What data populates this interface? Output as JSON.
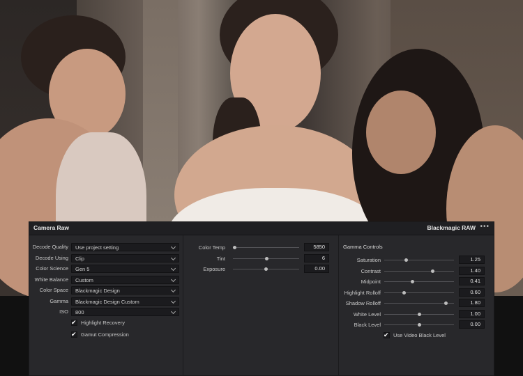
{
  "panel": {
    "title": "Camera Raw",
    "brand": "Blackmagic RAW",
    "menu_label": "•••"
  },
  "decode": {
    "rows": [
      {
        "label": "Decode Quality",
        "value": "Use project setting"
      },
      {
        "label": "Decode Using",
        "value": "Clip"
      },
      {
        "label": "Color Science",
        "value": "Gen 5"
      },
      {
        "label": "White Balance",
        "value": "Custom"
      },
      {
        "label": "Color Space",
        "value": "Blackmagic Design"
      },
      {
        "label": "Gamma",
        "value": "Blackmagic Design Custom"
      },
      {
        "label": "ISO",
        "value": "800"
      }
    ],
    "checkboxes": [
      {
        "label": "Highlight Recovery",
        "checked": true
      },
      {
        "label": "Gamut Compression",
        "checked": true
      }
    ]
  },
  "color": {
    "sliders": [
      {
        "label": "Color Temp",
        "value": "5850",
        "position": 0.03
      },
      {
        "label": "Tint",
        "value": "6",
        "position": 0.51
      },
      {
        "label": "Exposure",
        "value": "0.00",
        "position": 0.5
      }
    ]
  },
  "gamma": {
    "title": "Gamma Controls",
    "sliders": [
      {
        "label": "Saturation",
        "value": "1.25",
        "position": 0.31
      },
      {
        "label": "Contrast",
        "value": "1.40",
        "position": 0.69
      },
      {
        "label": "Midpoint",
        "value": "0.41",
        "position": 0.4
      },
      {
        "label": "Highlight Rolloff",
        "value": "0.60",
        "position": 0.28
      },
      {
        "label": "Shadow Rolloff",
        "value": "1.80",
        "position": 0.88
      },
      {
        "label": "White Level",
        "value": "1.00",
        "position": 0.5
      },
      {
        "label": "Black Level",
        "value": "0.00",
        "position": 0.5
      }
    ],
    "checkbox": {
      "label": "Use Video Black Level",
      "checked": true
    }
  },
  "icons": {
    "check": "✔"
  }
}
